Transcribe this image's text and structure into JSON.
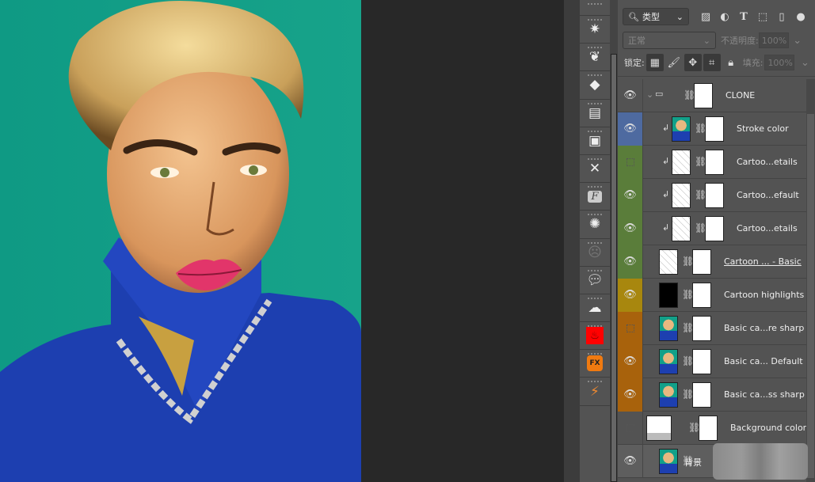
{
  "colors": {
    "teal": "#12a089",
    "blue": "#1d3fb0",
    "layer_blue": "#4e6aa0",
    "layer_green": "#5a7d3a",
    "layer_yellow": "#a8870e",
    "layer_orange": "#a8620c",
    "panel": "#535353",
    "pasteboard": "#282828"
  },
  "layers_panel": {
    "filter_label": "类型",
    "filter_icons": [
      "image-filter-icon",
      "adjustment-filter-icon",
      "type-filter-icon",
      "shape-filter-icon",
      "smart-object-filter-icon",
      "filter-toggle-icon"
    ],
    "blend_mode": "正常",
    "opacity_label": "不透明度:",
    "opacity_value": "100%",
    "lock_label": "锁定:",
    "fill_label": "填充:",
    "fill_value": "100%",
    "layers": [
      {
        "name": "CLONE",
        "type": "group",
        "visible": true,
        "color": ""
      },
      {
        "name": "Stroke color",
        "visible": true,
        "color": "blue",
        "clipped": true,
        "thumb": "photo"
      },
      {
        "name": "Cartoo...etails",
        "visible": false,
        "color": "green",
        "clipped": true,
        "thumb": "sketch"
      },
      {
        "name": "Cartoo...efault",
        "visible": true,
        "color": "green",
        "clipped": true,
        "thumb": "sketch"
      },
      {
        "name": "Cartoo...etails",
        "visible": true,
        "color": "green",
        "clipped": true,
        "thumb": "sketch"
      },
      {
        "name": "Cartoon ... - Basic",
        "visible": true,
        "color": "green",
        "clipped": false,
        "thumb": "sketch"
      },
      {
        "name": "Cartoon highlights",
        "visible": true,
        "color": "yellow",
        "clipped": false,
        "thumb": "black"
      },
      {
        "name": "Basic ca...re sharp",
        "visible": false,
        "color": "orange",
        "clipped": false,
        "thumb": "photo"
      },
      {
        "name": "Basic ca... Default",
        "visible": true,
        "color": "orange",
        "clipped": false,
        "thumb": "photo"
      },
      {
        "name": "Basic ca...ss sharp",
        "visible": true,
        "color": "orange",
        "clipped": false,
        "thumb": "photo"
      },
      {
        "name": "Background color",
        "visible": false,
        "color": "",
        "clipped": false,
        "thumb": "fill"
      },
      {
        "name": "背景",
        "visible": true,
        "color": "",
        "clipped": false,
        "thumb": "photo"
      }
    ]
  },
  "tools": [
    "sparkle-icon",
    "drop-icon",
    "shapes-icon",
    "layers-stack-icon",
    "squares-icon",
    "fork-brush-icon",
    "font-icon",
    "aperture-icon",
    "alien-icon",
    "speech-bubble-icon",
    "cloud-face-icon",
    "red-fire-plugin-icon",
    "fx-cube-icon",
    "wand-pen-icon"
  ]
}
